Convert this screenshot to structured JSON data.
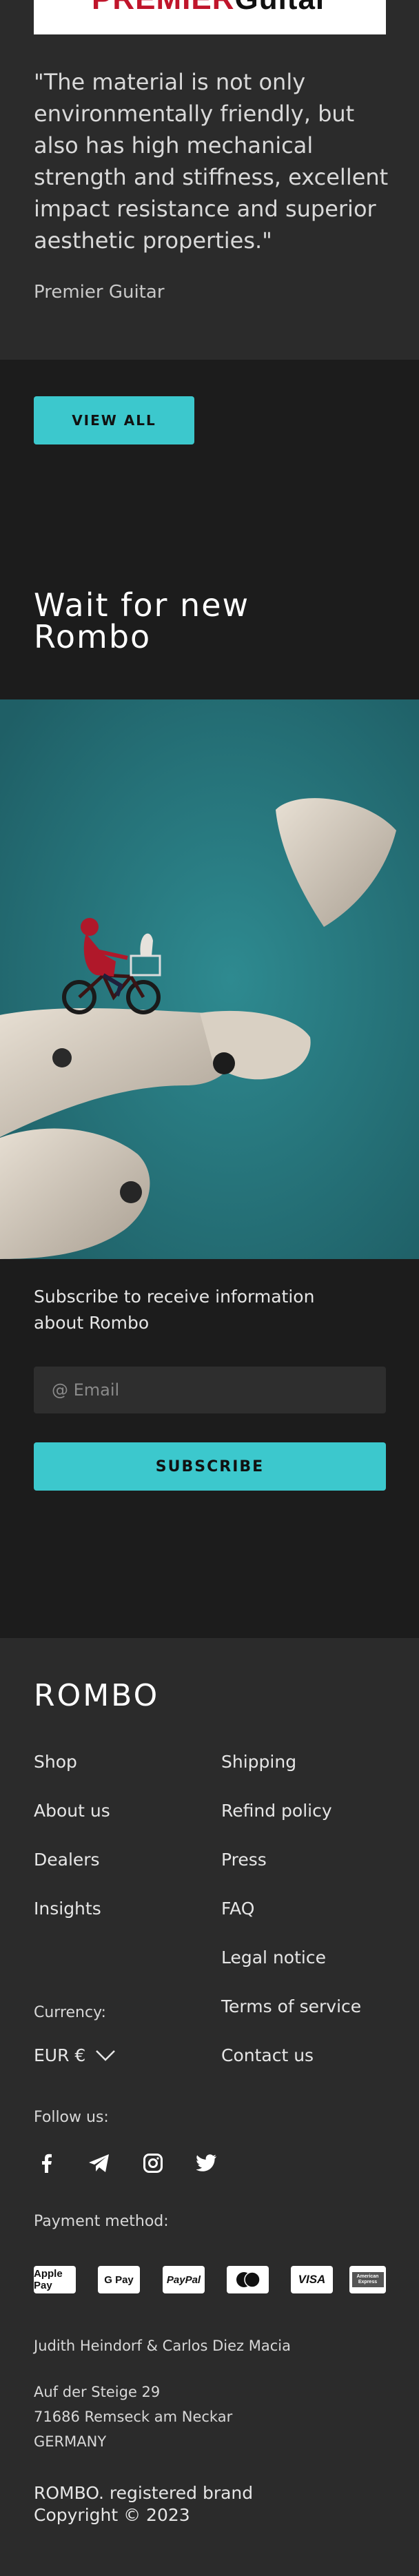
{
  "review": {
    "logo_part1": "PREMIER",
    "logo_part2": "Guitar",
    "quote": "\"The material is not only environmentally friendly, but also has high mechanical strength and stiffness, excellent impact resistance and superior aesthetic properties.\"",
    "author": "Premier Guitar"
  },
  "view_all_label": "VIEW ALL",
  "wait_title_line1": "Wait for new",
  "wait_title_line2": "Rombo",
  "subscribe": {
    "text": "Subscribe to receive information about Rombo",
    "email_placeholder": "@ Email",
    "button_label": "SUBSCRIBE"
  },
  "footer": {
    "brand": "ROMBO",
    "links_left": [
      "Shop",
      "About us",
      "Dealers",
      "Insights"
    ],
    "links_right": [
      "Shipping",
      "Refind policy",
      "Press",
      "FAQ",
      "Legal notice",
      "Terms of service",
      "Contact us"
    ],
    "currency_label": "Currency:",
    "currency_value": "EUR €",
    "follow_label": "Follow us:",
    "social_icons": [
      "facebook-icon",
      "telegram-icon",
      "instagram-icon",
      "twitter-icon"
    ],
    "payment_label": "Payment method:",
    "payment_methods": [
      "Apple Pay",
      "G Pay",
      "PayPal",
      "Mastercard",
      "VISA",
      "American Express"
    ],
    "owners": "Judith Heindorf & Carlos Diez Macia",
    "address_line1": "Auf der Steige 29",
    "address_line2": "71686 Remseck am Neckar",
    "address_line3": "GERMANY",
    "registered": "ROMBO. registered brand",
    "copyright": "Copyright  © 2023"
  },
  "colors": {
    "accent": "#3cc8cd",
    "dark_bg": "#1c1c1c",
    "panel_bg": "#2b2b2b",
    "photo_bg": "#2a7c82"
  }
}
